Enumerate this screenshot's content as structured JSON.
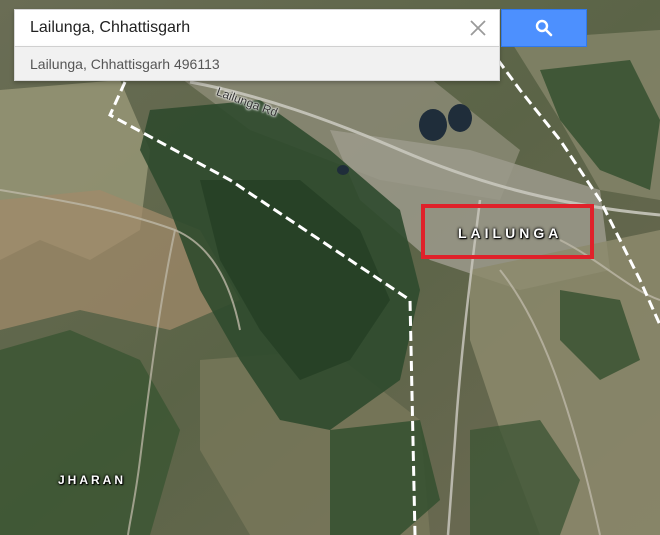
{
  "search": {
    "value": "Lailunga, Chhattisgarh",
    "suggestion": "Lailunga, Chhattisgarh 496113"
  },
  "map": {
    "road_label": "Lailunga Rd",
    "places": {
      "lailunga": "LAILUNGA",
      "jharan": "JHARAN"
    },
    "highlight_color": "#e0212a",
    "search_button_color": "#4d90fe"
  },
  "icons": {
    "clear": "close-icon",
    "search": "search-icon"
  }
}
